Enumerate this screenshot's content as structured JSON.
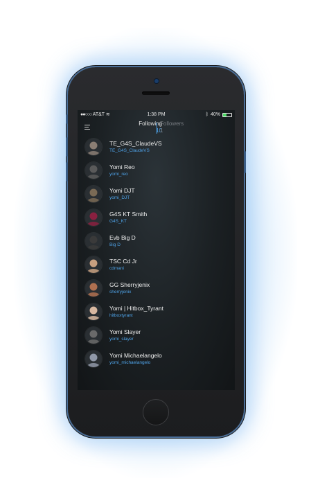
{
  "status_bar": {
    "carrier": "AT&T",
    "time": "1:38 PM",
    "battery": "40%",
    "battery_level": 0.4,
    "wifi_icon": "wifi-icon",
    "bluetooth_icon": "bluetooth-icon"
  },
  "header": {
    "menu_icon": "hamburger-menu-icon",
    "tabs": [
      {
        "label": "Following",
        "count": "10",
        "active": true
      },
      {
        "label": "Followers",
        "count": "1",
        "active": false
      }
    ]
  },
  "colors": {
    "accent": "#4fa3e8",
    "screen_bg": "#1b2023"
  },
  "following": [
    {
      "name": "TE_G4S_ClaudeVS",
      "handle": "TE_G4S_ClaudeVS",
      "avatar_color": "#8b7e74"
    },
    {
      "name": "Yomi Reo",
      "handle": "yomi_reo",
      "avatar_color": "#5a5a5a"
    },
    {
      "name": "Yomi DJT",
      "handle": "yomi_DJT",
      "avatar_color": "#7a6a55"
    },
    {
      "name": "G4S KT Smith",
      "handle": "G4S_KT",
      "avatar_color": "#8a2040"
    },
    {
      "name": "Evb Big D",
      "handle": "Big D",
      "avatar_color": "#3a3a3a"
    },
    {
      "name": "TSC Cd Jr",
      "handle": "cdmani",
      "avatar_color": "#c8a080"
    },
    {
      "name": "GG Sherryjenix",
      "handle": "sherryjenix",
      "avatar_color": "#b07050"
    },
    {
      "name": "Yomi | Hitbox_Tyrant",
      "handle": "hitboxtyrant",
      "avatar_color": "#d8b8a0"
    },
    {
      "name": "Yomi Slayer",
      "handle": "yomi_slayer",
      "avatar_color": "#6a6a6a"
    },
    {
      "name": "Yomi Michaelangelo",
      "handle": "yomi_michaelangelo",
      "avatar_color": "#9098a8"
    }
  ]
}
